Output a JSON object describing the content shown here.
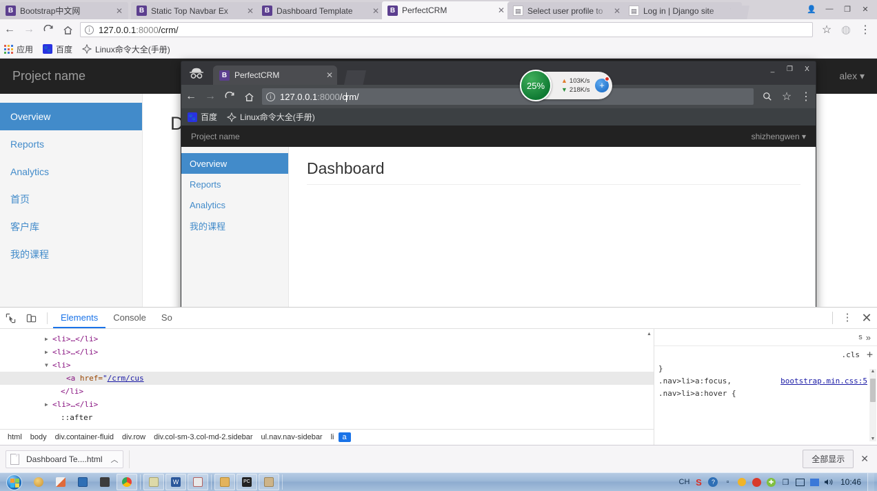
{
  "outer_browser": {
    "tabs": [
      {
        "title": "Bootstrap中文网",
        "favicon": "bootstrap-b-icon",
        "active": false
      },
      {
        "title": "Static Top Navbar Ex",
        "favicon": "bootstrap-b-icon",
        "active": false
      },
      {
        "title": "Dashboard Template",
        "favicon": "bootstrap-b-icon",
        "active": false
      },
      {
        "title": "PerfectCRM",
        "favicon": "bootstrap-b-icon",
        "active": true
      },
      {
        "title": "Select user profile to",
        "favicon": "page-icon",
        "active": false
      },
      {
        "title": "Log in | Django site",
        "favicon": "page-icon",
        "active": false
      }
    ],
    "tab_close_label": "✕",
    "window_controls": {
      "minimize": "—",
      "maximize": "❐",
      "close": "✕",
      "user": "👤"
    },
    "toolbar": {
      "back": "←",
      "forward": "→",
      "reload": "C",
      "home": "⌂",
      "url_host": "127.0.0.1",
      "url_port": ":8000",
      "url_path": "/crm/",
      "star": "☆",
      "profile": "◍",
      "menu": "⋮"
    },
    "bookmarks": [
      {
        "label": "应用",
        "icon": "apps-grid-icon"
      },
      {
        "label": "百度",
        "icon": "baidu-paw-icon"
      },
      {
        "label": "Linux命令大全(手册)",
        "icon": "compass-icon"
      }
    ]
  },
  "background_page": {
    "brand": "Project name",
    "user_menu": "alex ▾",
    "sidebar": [
      {
        "label": "Overview",
        "active": true
      },
      {
        "label": "Reports",
        "active": false
      },
      {
        "label": "Analytics",
        "active": false
      },
      {
        "label": "首页",
        "active": false
      },
      {
        "label": "客户库",
        "active": false
      },
      {
        "label": "我的课程",
        "active": false
      }
    ],
    "heading_partial": "D"
  },
  "incognito_window": {
    "incognito_icon": "incognito-hat-icon",
    "tab": {
      "title": "PerfectCRM",
      "favicon": "bootstrap-b-icon",
      "close": "✕"
    },
    "window_controls": {
      "minimize": "_",
      "maximize": "❐",
      "close": "X"
    },
    "toolbar": {
      "back": "←",
      "forward": "→",
      "reload": "C",
      "home": "⌂",
      "url_host": "127.0.0.1",
      "url_port": ":8000",
      "url_path_a": "/c",
      "url_path_b": "rm/",
      "zoom_search": "🔍",
      "star": "☆",
      "menu": "⋮"
    },
    "bookmarks": [
      {
        "label": "百度",
        "icon": "baidu-paw-icon"
      },
      {
        "label": "Linux命令大全(手册)",
        "icon": "compass-icon"
      }
    ],
    "page": {
      "brand": "Project name",
      "user_menu": "shizhengwen ▾",
      "sidebar": [
        {
          "label": "Overview",
          "active": true
        },
        {
          "label": "Reports",
          "active": false
        },
        {
          "label": "Analytics",
          "active": false
        },
        {
          "label": "我的课程",
          "active": false
        }
      ],
      "heading": "Dashboard"
    }
  },
  "speed_widget": {
    "percent": "25%",
    "upload": "103K/s",
    "download": "218K/s",
    "up_arrow": "▲",
    "down_arrow": "▼",
    "plus": "+",
    "accent_green": "#0f7a33",
    "accent_blue": "#1565c0",
    "badge_red": "#d93025"
  },
  "devtools": {
    "inspect_icon": "inspect-cursor-icon",
    "device_icon": "device-toolbar-icon",
    "tabs": [
      {
        "label": "Elements",
        "active": true
      },
      {
        "label": "Console",
        "active": false
      },
      {
        "label": "So",
        "active": false
      }
    ],
    "kebab": "⋮",
    "close": "✕",
    "dom_rows": [
      {
        "indent": 0,
        "triangle": "▶",
        "text": "<li>…</li>",
        "selected": false,
        "type": "collapsed"
      },
      {
        "indent": 0,
        "triangle": "▶",
        "text": "<li>…</li>",
        "selected": false,
        "type": "collapsed"
      },
      {
        "indent": 0,
        "triangle": "▼",
        "text": "<li>",
        "selected": false,
        "type": "open"
      },
      {
        "indent": 1,
        "triangle": "",
        "text": "<a href=\"/crm/cus",
        "selected": true,
        "type": "anchor"
      },
      {
        "indent": 0,
        "triangle": "",
        "text": "</li>",
        "selected": false,
        "type": "close"
      },
      {
        "indent": 0,
        "triangle": "▶",
        "text": "<li>…</li>",
        "selected": false,
        "type": "collapsed"
      },
      {
        "indent": 0,
        "triangle": "",
        "text": "::after",
        "selected": false,
        "type": "pseudo"
      }
    ],
    "anchor_tag_open": "<a",
    "anchor_attr": "href=",
    "anchor_quote": "\"",
    "anchor_href": "/crm/cus",
    "breadcrumb": [
      {
        "label": "html",
        "selected": false
      },
      {
        "label": "body",
        "selected": false
      },
      {
        "label": "div.container-fluid",
        "selected": false
      },
      {
        "label": "div.row",
        "selected": false
      },
      {
        "label": "div.col-sm-3.col-md-2.sidebar",
        "selected": false
      },
      {
        "label": "ul.nav.nav-sidebar",
        "selected": false
      },
      {
        "label": "li",
        "selected": false
      },
      {
        "label": "a",
        "selected": true
      }
    ],
    "styles": {
      "filter_tail": "s",
      "more_chevron": "»",
      "cls_label": ".cls",
      "plus_label": "+",
      "brace_close": "}",
      "rule_selector": ".nav>li>a:focus,",
      "rule_source": "bootstrap.min.css:5",
      "rule_selector2": ".nav>li>a:hover {",
      "scroll_up": "▲",
      "scroll_down": "▼"
    }
  },
  "download_bar": {
    "file_icon": "file-icon",
    "file_name": "Dashboard Te....html",
    "chevron": "︿",
    "show_all_label": "全部显示",
    "close": "✕"
  },
  "taskbar": {
    "start": "windows-start-orb",
    "pinned": [
      {
        "icon": "paint-palette-icon",
        "color": "#e8b54d",
        "framed": false
      },
      {
        "icon": "paint-brush-icon",
        "color": "#e0e0e0",
        "framed": false
      },
      {
        "icon": "save-floppy-icon",
        "color": "#2f6fb5",
        "framed": false
      },
      {
        "icon": "media-player-icon",
        "color": "#3c3c3c",
        "framed": false
      },
      {
        "icon": "chrome-icon",
        "color": "#4285f4",
        "framed": true
      },
      {
        "icon": "notepad-icon",
        "color": "#d8d4a8",
        "framed": true
      },
      {
        "icon": "word-icon",
        "color": "#2b579a",
        "framed": true
      },
      {
        "icon": "chart-icon",
        "color": "#c0504d",
        "framed": true
      },
      {
        "icon": "folder-icon",
        "color": "#e0b25c",
        "framed": true
      },
      {
        "icon": "pycharm-icon",
        "color": "#222222",
        "framed": true
      },
      {
        "icon": "camera-icon",
        "color": "#c9a96a",
        "framed": true
      }
    ],
    "tray": [
      {
        "icon": "input-method-ch",
        "label": "CH"
      },
      {
        "icon": "sogou-icon",
        "label": "S"
      },
      {
        "icon": "help-icon",
        "label": "?"
      },
      {
        "icon": "overflow-icon",
        "label": "▫"
      },
      {
        "icon": "cloud-icon",
        "label": "●"
      },
      {
        "icon": "red-circle-icon",
        "label": "●"
      },
      {
        "icon": "shield-icon",
        "label": "✚"
      },
      {
        "icon": "copy-icon",
        "label": "❐"
      },
      {
        "icon": "network-icon",
        "label": "🖧"
      },
      {
        "icon": "display-icon",
        "label": "▤"
      },
      {
        "icon": "volume-icon",
        "label": "🔊"
      }
    ],
    "clock": "10:46"
  }
}
